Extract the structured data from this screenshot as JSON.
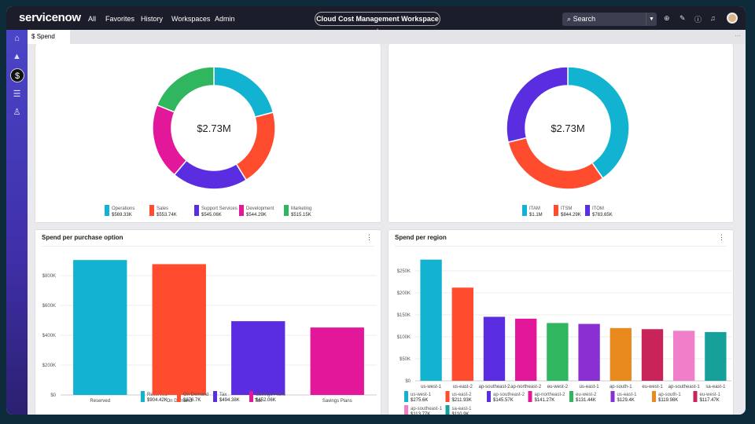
{
  "header": {
    "logo": "servicenow",
    "nav": [
      "All",
      "Favorites",
      "History",
      "Workspaces",
      "Admin"
    ],
    "workspace": "Cloud Cost Management Workspace",
    "star_icon": "star-icon",
    "search_placeholder": "Search",
    "icons": [
      "globe-icon",
      "chat-icon",
      "help-icon",
      "bell-icon"
    ]
  },
  "sidebar": {
    "items": [
      {
        "icon": "home-icon"
      },
      {
        "icon": "chart-icon"
      },
      {
        "icon": "dollar-icon",
        "active": true,
        "glyph": "$"
      },
      {
        "icon": "list-icon"
      },
      {
        "icon": "user-icon"
      }
    ]
  },
  "tabs": [
    {
      "icon": "$",
      "label": "Spend"
    }
  ],
  "colors": {
    "cyan": "#12b3d0",
    "red": "#ff4b2e",
    "purple": "#5a2ee0",
    "magenta": "#e3179a",
    "green": "#2fb65e",
    "violet": "#8a2fd1",
    "orange": "#e88a1e",
    "crimson": "#c8245a",
    "pink": "#f07ec8",
    "teal": "#16a09a"
  },
  "chart_data": [
    {
      "type": "pie",
      "center_label": "$2.73M",
      "categories": [
        "Operations",
        "Sales",
        "Support Services",
        "Development",
        "Marketing"
      ],
      "values": [
        569.33,
        553.74,
        545.06,
        544.29,
        515.15
      ],
      "labels": [
        "$569.33K",
        "$553.74K",
        "$545.06K",
        "$544.29K",
        "$515.15K"
      ],
      "colors": [
        "#12b3d0",
        "#ff4b2e",
        "#5a2ee0",
        "#e3179a",
        "#2fb65e"
      ]
    },
    {
      "type": "pie",
      "center_label": "$2.73M",
      "categories": [
        "ITAM",
        "ITSM",
        "ITOM"
      ],
      "values": [
        1100,
        844.29,
        783.65
      ],
      "labels": [
        "$1.1M",
        "$844.29K",
        "$783.65K"
      ],
      "colors": [
        "#12b3d0",
        "#ff4b2e",
        "#5a2ee0"
      ]
    },
    {
      "type": "bar",
      "title": "Spend per purchase option",
      "categories": [
        "Reserved",
        "On Demand",
        "Tax",
        "Savings Plans"
      ],
      "values": [
        904.42,
        876.7,
        494.38,
        452.06
      ],
      "labels": [
        "$904.42K",
        "$876.7K",
        "$494.38K",
        "$452.06K"
      ],
      "colors": [
        "#12b3d0",
        "#ff4b2e",
        "#5a2ee0",
        "#e3179a"
      ],
      "yticks": [
        "$0",
        "$200K",
        "$400K",
        "$600K",
        "$800K"
      ],
      "ylim": [
        0,
        1000
      ]
    },
    {
      "type": "bar",
      "title": "Spend per region",
      "categories": [
        "us-west-1",
        "us-east-2",
        "ap-southeast-2",
        "ap-northeast-2",
        "eu-west-2",
        "us-east-1",
        "ap-south-1",
        "eu-west-1",
        "ap-southeast-1",
        "sa-east-1"
      ],
      "values": [
        275.6,
        211.93,
        145.57,
        141.27,
        131.44,
        129.4,
        119.98,
        117.47,
        113.77,
        110.9
      ],
      "labels": [
        "$275.6K",
        "$211.93K",
        "$145.57K",
        "$141.27K",
        "$131.44K",
        "$129.4K",
        "$119.98K",
        "$117.47K",
        "$113.77K",
        "$110.9K"
      ],
      "colors": [
        "#12b3d0",
        "#ff4b2e",
        "#5a2ee0",
        "#e3179a",
        "#2fb65e",
        "#8a2fd1",
        "#e88a1e",
        "#c8245a",
        "#f07ec8",
        "#16a09a"
      ],
      "yticks": [
        "$0",
        "$50K",
        "$100K",
        "$150K",
        "$200K",
        "$250K"
      ],
      "ylim": [
        0,
        300
      ]
    }
  ]
}
